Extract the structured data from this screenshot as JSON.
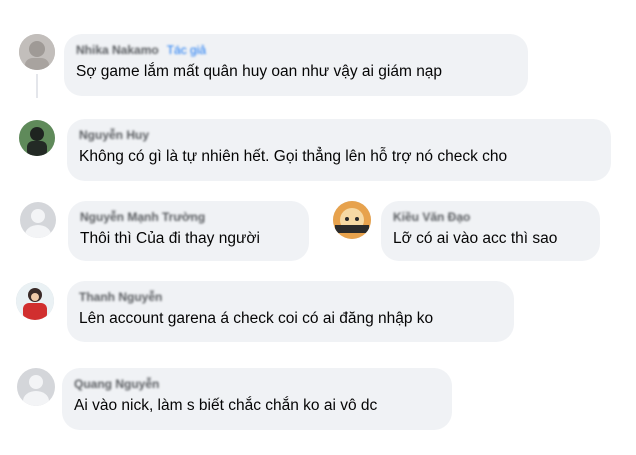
{
  "comments": [
    {
      "author": "Nhika Nakamo",
      "tag": "Tác giả",
      "text": "Sợ game lắm mất quân huy oan như vậy ai giám nạp",
      "avatar_color": "#b9b4b0"
    },
    {
      "author": "Nguyễn Huy",
      "tag": "",
      "text": "Không có gì là tự nhiên hết. Gọi thẳng lên hỗ trợ nó check cho",
      "avatar_color": "#3a4a3a"
    },
    {
      "author": "Nguyễn Mạnh Trường",
      "tag": "",
      "text": "Thôi thì Của đi thay người",
      "avatar_color": "default"
    },
    {
      "author": "Kiều Văn Đạo",
      "tag": "",
      "text": "Lỡ có ai vào acc thì sao",
      "avatar_color": "#d98a3a"
    },
    {
      "author": "Thanh Nguyễn",
      "tag": "",
      "text": "Lên account garena á check coi có ai đăng nhập ko",
      "avatar_color": "#c83a3a"
    },
    {
      "author": "Quang Nguyễn",
      "tag": "",
      "text": "Ai vào nick, làm s biết chắc chắn ko ai vô dc",
      "avatar_color": "default"
    }
  ]
}
